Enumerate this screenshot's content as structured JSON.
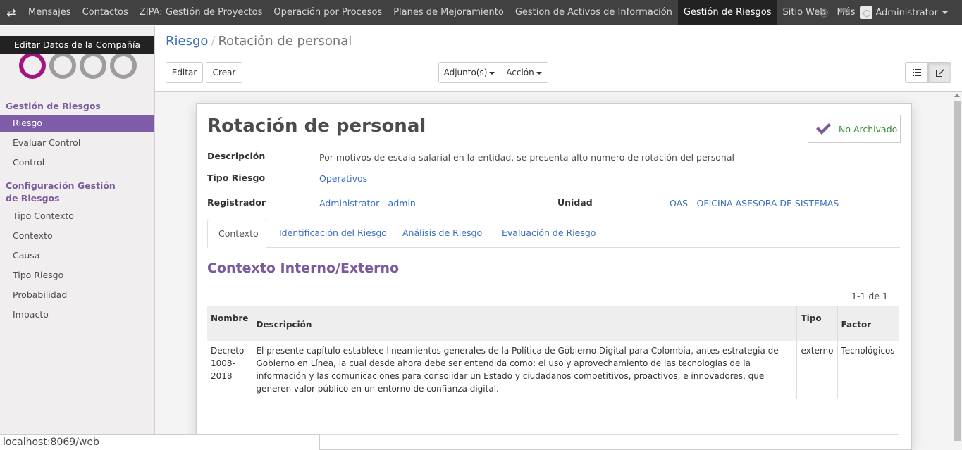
{
  "topbar": {
    "menu": [
      {
        "label": "Mensajes",
        "active": false
      },
      {
        "label": "Contactos",
        "active": false
      },
      {
        "label": "ZIPA: Gestión de Proyectos",
        "active": false
      },
      {
        "label": "Operación por Procesos",
        "active": false
      },
      {
        "label": "Planes de Mejoramiento",
        "active": false
      },
      {
        "label": "Gestion de Activos de Información",
        "active": false
      },
      {
        "label": "Gestión de Riesgos",
        "active": true
      },
      {
        "label": "Sitio Web",
        "active": false
      },
      {
        "label": "Más",
        "active": false
      }
    ],
    "user": "Administrator"
  },
  "sidebar": {
    "company_tooltip": "Editar Datos de la Compañía",
    "section1": "Gestión de Riesgos",
    "section1_items": [
      "Riesgo",
      "Evaluar Control",
      "Control"
    ],
    "section2": "Configuración Gestión de Riesgos",
    "section2_items": [
      "Tipo Contexto",
      "Contexto",
      "Causa",
      "Tipo Riesgo",
      "Probabilidad",
      "Impacto"
    ],
    "active_item": "Riesgo"
  },
  "breadcrumb": {
    "parent": "Riesgo",
    "current": "Rotación de personal"
  },
  "buttons": {
    "edit": "Editar",
    "create": "Crear",
    "attachments": "Adjunto(s)",
    "action": "Acción"
  },
  "record": {
    "title": "Rotación de personal",
    "status": "No Archivado",
    "fields": {
      "descripcion_label": "Descripción",
      "descripcion": "Por motivos de escala salarial en la entidad, se presenta alto numero de rotación del personal",
      "tipo_label": "Tipo Riesgo",
      "tipo": "Operativos",
      "registrador_label": "Registrador",
      "registrador": "Administrator - admin",
      "unidad_label": "Unidad",
      "unidad": "OAS - OFICINA ASESORA DE SISTEMAS"
    }
  },
  "tabs": [
    "Contexto",
    "Identificación del Riesgo",
    "Análisis de Riesgo",
    "Evaluación de Riesgo"
  ],
  "context": {
    "section_title": "Contexto Interno/Externo",
    "pager": "1-1 de 1",
    "columns": [
      "Nombre",
      "Descripción",
      "Tipo",
      "Factor"
    ],
    "rows": [
      {
        "nombre": "Decreto 1008-2018",
        "descripcion": "El presente capítulo establece lineamientos generales de la Política de Gobierno Digital para Colombia, antes estrategia de Gobierno en Línea, la cual desde ahora debe ser entendida como: el uso y aprovechamiento de las tecnologías de la información y las comunicaciones para consolidar un Estado y ciudadanos competitivos, proactivos, e innovadores, que generen valor público en un entorno de confianza digital.",
        "tipo": "externo",
        "factor": "Tecnológicos"
      }
    ]
  },
  "status_url": "localhost:8069/web",
  "colors": {
    "brand_purple": "#7c5b9c",
    "link_blue": "#3a6fbf",
    "navbar": "#414141",
    "active_sidebar": "#7e5ca8",
    "status_green": "#3a8a3a"
  }
}
